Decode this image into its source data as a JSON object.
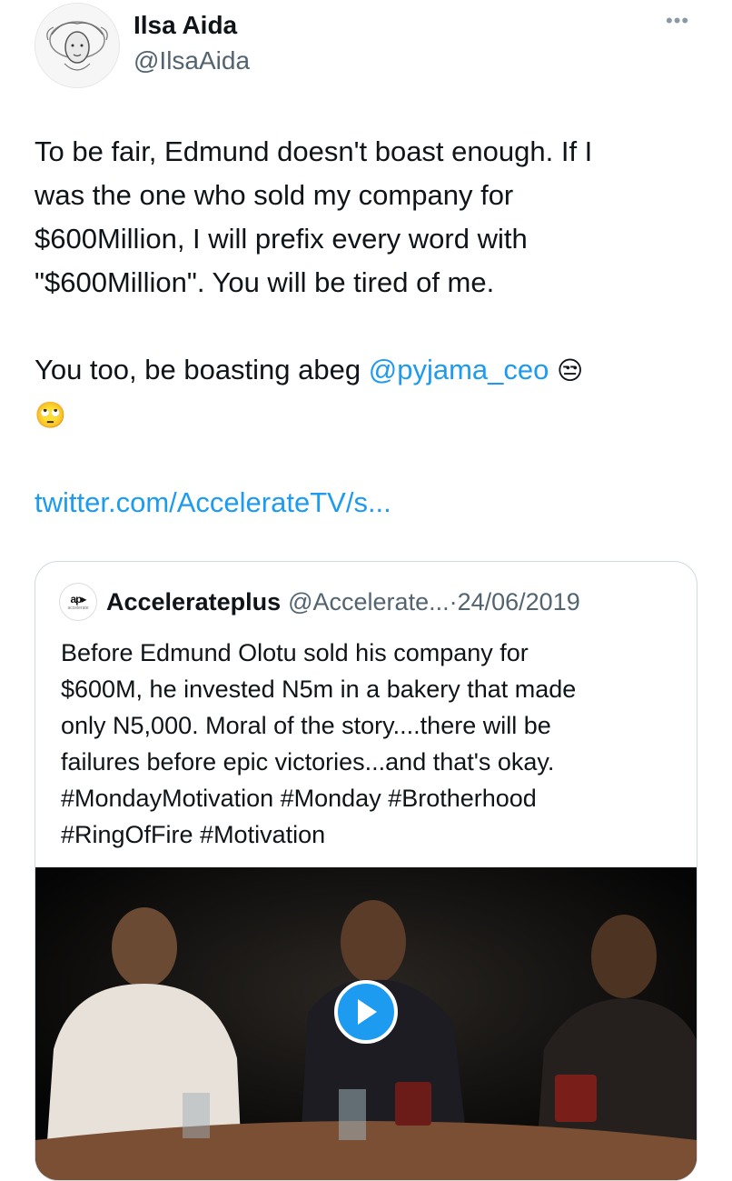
{
  "author": {
    "name": "Ilsa Aida",
    "handle": "@IlsaAida",
    "more_label": "•••"
  },
  "tweet": {
    "line1": "To be fair, Edmund doesn't boast enough. If I",
    "line2": "was the one who sold my company for",
    "line3": "$600Million, I will prefix every word with",
    "line4": "\"$600Million\". You will be tired of me.",
    "line5_prefix": "You too, be boasting abeg ",
    "mention": "@pyjama_ceo",
    "emoji1": "😒",
    "emoji2": "🙄",
    "link": "twitter.com/AccelerateTV/s..."
  },
  "quoted": {
    "logo_mark": "ap▸",
    "logo_sub": "accelerate",
    "name": "Accelerateplus",
    "handle": "@Accelerate...",
    "separator": " · ",
    "date": "24/06/2019",
    "text": "Before Edmund Olotu sold his company for\n$600M, he invested N5m in a bakery that made\nonly N5,000. Moral of the story....there will be\nfailures before epic victories...and that's okay.\n#MondayMotivation #Monday #Brotherhood\n#RingOfFire #Motivation"
  },
  "colors": {
    "link_blue": "#1d9bf0",
    "secondary_text": "#536471",
    "border": "#cfd9de"
  },
  "icons": {
    "more": "more-dots-icon",
    "play": "play-icon"
  }
}
